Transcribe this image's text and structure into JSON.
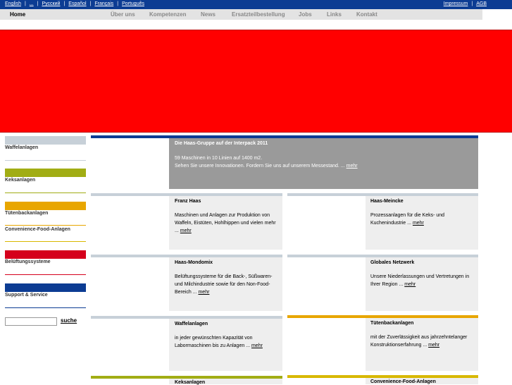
{
  "colors": {
    "topbar": "#0c3c93",
    "banner": "#ff0000",
    "waffel": "#c7d0d8",
    "keks": "#a1ad14",
    "tueten": "#e8a600",
    "convenience": "#d8b800",
    "belueftung": "#d5001c",
    "support": "#0c3c93"
  },
  "languages": [
    "English",
    "...",
    "Русский",
    "Español",
    "Français",
    "Português"
  ],
  "legal": {
    "impressum": "Impressum",
    "agb": "AGB"
  },
  "nav": {
    "home": "Home",
    "ueber": "Über uns",
    "kompetenzen": "Kompetenzen",
    "news": "News",
    "ersatzteil": "Ersatzteilbestellung",
    "jobs": "Jobs",
    "links": "Links",
    "kontakt": "Kontakt"
  },
  "sidebar": [
    {
      "label": "Waffelanlagen"
    },
    {
      "label": "Keksanlagen"
    },
    {
      "label": "Tütenbackanlagen"
    },
    {
      "label": "Convenience-Food-Anlagen"
    },
    {
      "label": "Belüftungssysteme"
    },
    {
      "label": "Support & Service"
    }
  ],
  "search": {
    "button": "suche",
    "value": ""
  },
  "more_label": "mehr",
  "feature": {
    "title": "Die Haas-Gruppe auf der Interpack 2011",
    "line1": "59 Maschinen in 10 Linien auf 1400 m2.",
    "line2": "Sehen Sie unsere Innovationen. Fordern Sie uns auf unserem Messestand. ..."
  },
  "boxes": {
    "franz_haas": {
      "title": "Franz Haas",
      "text": "Maschinen und Anlagen zur Produktion von Waffeln, Eistüten, Hohlhippen und vielen mehr ..."
    },
    "haas_meincke": {
      "title": "Haas-Meincke",
      "text": "Prozessanlagen für die Keks- und Kuchenindustrie ..."
    },
    "haas_mondomix": {
      "title": "Haas-Mondomix",
      "text": "Belüftungssysteme für die Back-, Süßwaren- und Milchindustrie sowie für den Non-Food-Bereich ..."
    },
    "globales_netzwerk": {
      "title": "Globales Netzwerk",
      "text": "Unsere Niederlassungen und Vertretungen in Ihrer Region ..."
    },
    "waffelanlagen": {
      "title": "Waffelanlagen",
      "text": "in jeder gewünschten Kapazität von Labormaschinen bis zu Anlagen ..."
    },
    "tuetenbackanlagen": {
      "title": "Tütenbackanlagen",
      "text": "mit der Zuverlässigkeit aus jahrzehntelanger Konstruktionserfahrung ..."
    },
    "keksanlagen": {
      "title": "Keksanlagen"
    },
    "convenience": {
      "title": "Convenience-Food-Anlagen"
    }
  }
}
